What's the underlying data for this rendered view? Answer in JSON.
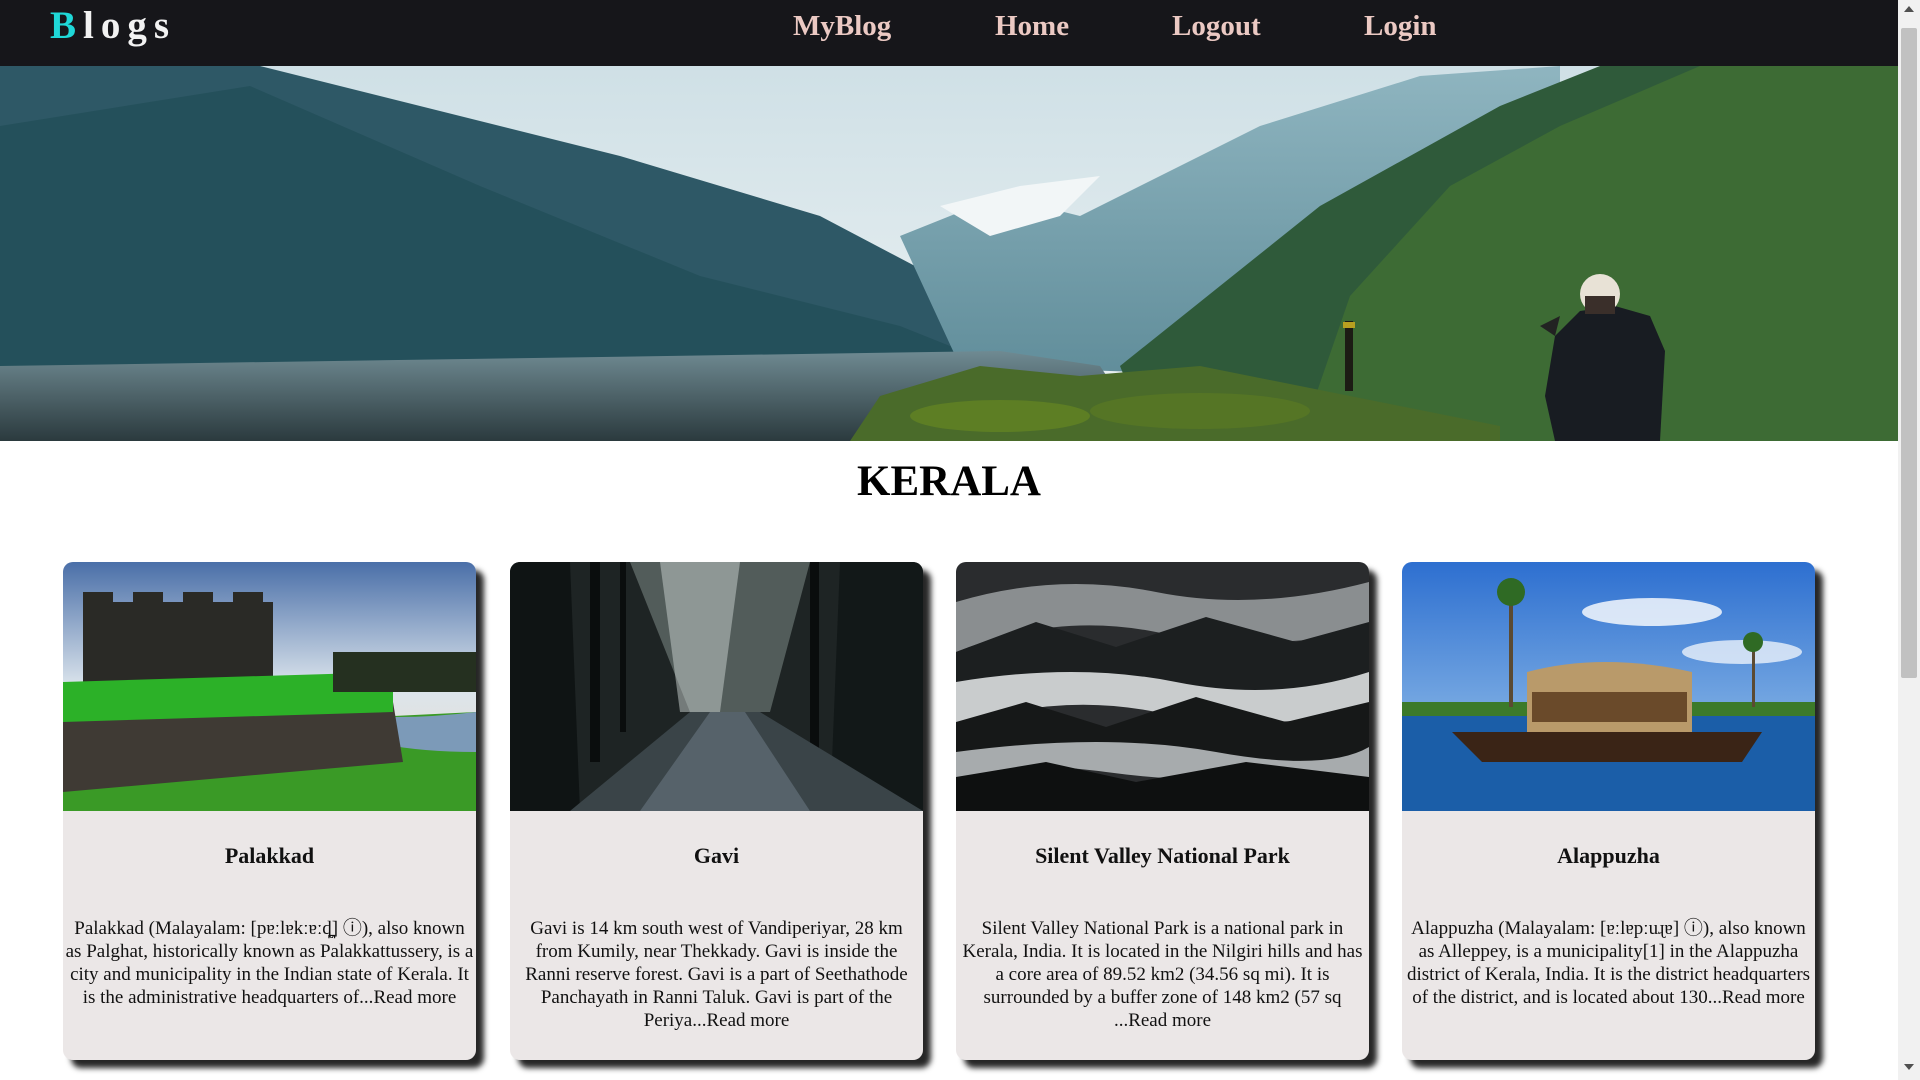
{
  "navbar": {
    "brand_first": "B",
    "brand_rest": "logs",
    "links": [
      "MyBlog",
      "Home",
      "Logout",
      "Login"
    ]
  },
  "page": {
    "title": "KERALA"
  },
  "cards": [
    {
      "title": "Palakkad",
      "excerpt": "Palakkad (Malayalam: [pɐːlɐkːɐːɖ̪] ⓘ), also known as Palghat, historically known as Palakkattussery, is a city and municipality in the Indian state of Kerala. It is the administrative headquarters of...",
      "read_more": "Read more"
    },
    {
      "title": "Gavi",
      "excerpt": "Gavi is 14 km south west of Vandiperiyar, 28 km from Kumily, near Thekkady. Gavi is inside the Ranni reserve forest. Gavi is a part of Seethathode Panchayath in Ranni Taluk. Gavi is part of the Periya...",
      "read_more": "Read more"
    },
    {
      "title": "Silent Valley National Park",
      "excerpt": "Silent Valley National Park is a national park in Kerala, India. It is located in the Nilgiri hills and has a core area of 89.52 km2 (34.56 sq mi). It is surrounded by a buffer zone of 148 km2 (57 sq ...",
      "read_more": "Read more"
    },
    {
      "title": "Alappuzha",
      "excerpt": "Alappuzha (Malayalam: [ɐːlɐpːuɻɐ] ⓘ), also known as Alleppey, is a municipality[1] in the Alappuzha district of Kerala, India. It is the district headquarters of the district, and is located about 130...",
      "read_more": "Read more"
    }
  ],
  "colors": {
    "navbar_bg": "#16161a",
    "brand_accent": "#1fd8d8",
    "nav_link": "#ebc9c3",
    "card_bg": "#ebe7e7"
  }
}
